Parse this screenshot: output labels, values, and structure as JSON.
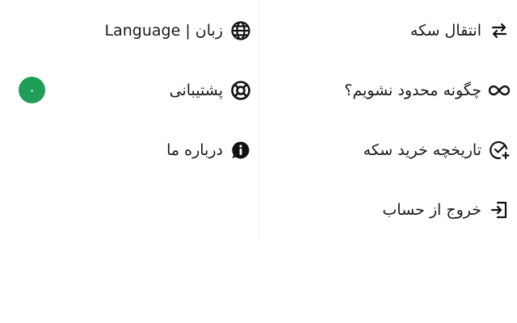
{
  "right_menu": {
    "items": [
      {
        "label": "انتقال سکه",
        "icon": "transfer-icon"
      },
      {
        "label": "چگونه محدود نشویم؟",
        "icon": "infinity-icon"
      },
      {
        "label": "تاریخچه خرید سکه",
        "icon": "purchase-history-icon"
      },
      {
        "label": "خروج از حساب",
        "icon": "logout-icon"
      }
    ]
  },
  "left_menu": {
    "items": [
      {
        "label": "زبان | Language",
        "icon": "globe-icon"
      },
      {
        "label": "پشتیبانی",
        "icon": "lifebuoy-icon"
      },
      {
        "label": "درباره ما",
        "icon": "info-chat-icon"
      }
    ]
  },
  "badge": {
    "text": "۰",
    "color": "#1e9e57"
  }
}
